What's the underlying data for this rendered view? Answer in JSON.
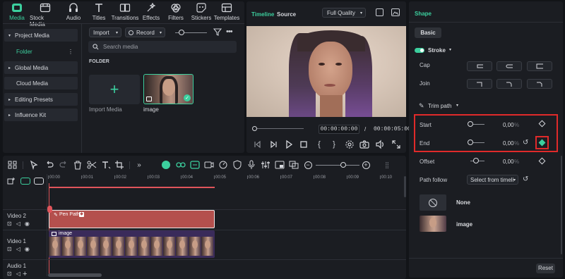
{
  "tabs": [
    {
      "label": "Media",
      "icon": "media-icon",
      "active": true
    },
    {
      "label": "Stock Media",
      "icon": "stock-media-icon"
    },
    {
      "label": "Audio",
      "icon": "audio-icon"
    },
    {
      "label": "Titles",
      "icon": "titles-icon"
    },
    {
      "label": "Transitions",
      "icon": "transitions-icon"
    },
    {
      "label": "Effects",
      "icon": "effects-icon"
    },
    {
      "label": "Filters",
      "icon": "filters-icon"
    },
    {
      "label": "Stickers",
      "icon": "stickers-icon"
    },
    {
      "label": "Templates",
      "icon": "templates-icon"
    }
  ],
  "sidebar": {
    "items": [
      {
        "label": "Project Media"
      },
      {
        "label": "Folder"
      },
      {
        "label": "Global Media"
      },
      {
        "label": "Cloud Media"
      },
      {
        "label": "Editing Presets"
      },
      {
        "label": "Influence Kit"
      }
    ]
  },
  "media": {
    "import_label": "Import",
    "record_label": "Record",
    "search_placeholder": "Search media",
    "folder_title": "FOLDER",
    "import_tile_label": "Import Media",
    "image_label": "image"
  },
  "preview": {
    "tab_timeline": "Timeline",
    "tab_source": "Source",
    "quality": "Full Quality",
    "current_time": "00:00:00:00",
    "separator": "/",
    "total_time": "00:00:05:00"
  },
  "timeline": {
    "ruler": [
      "00:00",
      "00:01",
      "00:02",
      "00:03",
      "00:04",
      "00:05",
      "00:06",
      "00:07",
      "00:08",
      "00:09",
      "00:10"
    ],
    "tracks": [
      {
        "label": "Video 2"
      },
      {
        "label": "Video 1"
      },
      {
        "label": "Audio 1"
      }
    ],
    "clip_pen": "Pen Path",
    "clip_image": "image",
    "playhead_color": "#e0555b"
  },
  "shape": {
    "panel_title": "Shape",
    "tab_basic": "Basic",
    "stroke_label": "Stroke",
    "cap_label": "Cap",
    "join_label": "Join",
    "trim_label": "Trim path",
    "start_label": "Start",
    "start_value": "0,00",
    "start_unit": "%",
    "end_label": "End",
    "end_value": "0,00",
    "end_unit": "%",
    "offset_label": "Offset",
    "offset_value": "0,00",
    "offset_unit": "%",
    "path_follow_label": "Path follow",
    "path_follow_value": "Select from timeli",
    "option_none": "None",
    "option_image": "image",
    "reset_label": "Reset",
    "accent": "#3ccf9e",
    "highlight": "#e02a2a"
  }
}
